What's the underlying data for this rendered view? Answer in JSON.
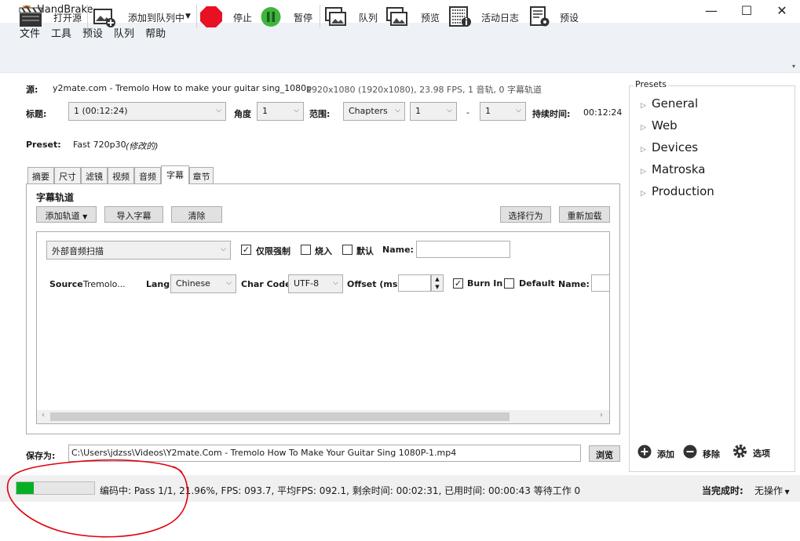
{
  "window": {
    "title": "HandBrake",
    "minimize": "—",
    "maximize": "☐",
    "close": "✕"
  },
  "menu": [
    "文件",
    "工具",
    "预设",
    "队列",
    "帮助"
  ],
  "toolbar": {
    "open_source": "打开源",
    "add_to_queue": "添加到队列中",
    "stop": "停止",
    "pause": "暂停",
    "queue": "队列",
    "preview": "预览",
    "activity_log": "活动日志",
    "presets": "预设"
  },
  "source": {
    "label": "源:",
    "name": "y2mate.com - Tremolo How to make your guitar sing_1080p",
    "info": "1920x1080 (1920x1080), 23.98 FPS, 1 音轨, 0 字幕轨道"
  },
  "title_row": {
    "title_label": "标题:",
    "title_value": "1 (00:12:24)",
    "angle_label": "角度",
    "angle_value": "1",
    "range_label": "范围:",
    "range_type": "Chapters",
    "range_start": "1",
    "dash": "-",
    "range_end": "1",
    "duration_label": "持续时间:",
    "duration_value": "00:12:24"
  },
  "preset_row": {
    "label": "Preset:",
    "value": "Fast 720p30",
    "modified": "(修改的)"
  },
  "tabs": [
    "摘要",
    "尺寸",
    "滤镜",
    "视频",
    "音频",
    "字幕",
    "章节"
  ],
  "active_tab": "字幕",
  "subtitles": {
    "section_title": "字幕轨道",
    "add_track": "添加轨道",
    "import": "导入字幕",
    "clear": "清除",
    "select_behavior": "选择行为",
    "reload": "重新加载",
    "row1": {
      "track": "外部音频扫描",
      "forced_only": "仅限强制",
      "forced_checked": true,
      "burn_in": "烧入",
      "burn_checked": false,
      "default": "默认",
      "default_checked": false,
      "name_label": "Name:",
      "name_value": ""
    },
    "row2": {
      "source_label": "Source",
      "source_value": "Tremolo...",
      "lang_label": "Lang",
      "lang_value": "Chinese",
      "charcode_label": "Char Code",
      "charcode_value": "UTF-8",
      "offset_label": "Offset (ms)",
      "offset_value": "",
      "burn_in": "Burn In",
      "burn_checked": true,
      "default": "Default",
      "default_checked": false,
      "name_label": "Name:"
    }
  },
  "save": {
    "label": "保存为:",
    "path": "C:\\Users\\jdzss\\Videos\\Y2mate.Com - Tremolo How To Make Your Guitar Sing 1080P-1.mp4",
    "browse": "浏览"
  },
  "presets_panel": {
    "title": "Presets",
    "items": [
      "General",
      "Web",
      "Devices",
      "Matroska",
      "Production"
    ],
    "add": "添加",
    "remove": "移除",
    "options": "选项"
  },
  "status": {
    "progress": 0.2196,
    "text": "编码中: Pass 1/1,  21.96%, FPS: 093.7, 平均FPS: 092.1, 剩余时间: 00:02:31, 已用时间: 00:00:43   等待工作 0",
    "when_done_label": "当完成时:",
    "when_done_value": "无操作"
  },
  "colors": {
    "accent": "#06b025",
    "stop": "#e81123",
    "pause": "#3fb43f",
    "annotation": "#e0000b"
  }
}
